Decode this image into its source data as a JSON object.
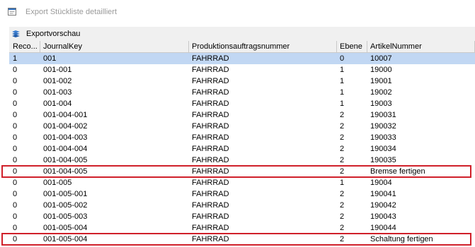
{
  "window": {
    "title": "Export Stückliste detailliert"
  },
  "toolbar": {
    "export_preview_label": "Exportvorschau"
  },
  "table": {
    "columns": [
      "Reco...",
      "JournalKey",
      "Produktionsauftragsnummer",
      "Ebene",
      "ArtikelNummer"
    ],
    "rows": [
      {
        "reco": "1",
        "journal_key": "001",
        "auftrag": "FAHRRAD",
        "ebene": "0",
        "artikel": "10007",
        "selected": true,
        "highlighted": false
      },
      {
        "reco": "0",
        "journal_key": "001-001",
        "auftrag": "FAHRRAD",
        "ebene": "1",
        "artikel": "19000",
        "selected": false,
        "highlighted": false
      },
      {
        "reco": "0",
        "journal_key": "001-002",
        "auftrag": "FAHRRAD",
        "ebene": "1",
        "artikel": "19001",
        "selected": false,
        "highlighted": false
      },
      {
        "reco": "0",
        "journal_key": "001-003",
        "auftrag": "FAHRRAD",
        "ebene": "1",
        "artikel": "19002",
        "selected": false,
        "highlighted": false
      },
      {
        "reco": "0",
        "journal_key": "001-004",
        "auftrag": "FAHRRAD",
        "ebene": "1",
        "artikel": "19003",
        "selected": false,
        "highlighted": false
      },
      {
        "reco": "0",
        "journal_key": "001-004-001",
        "auftrag": "FAHRRAD",
        "ebene": "2",
        "artikel": "190031",
        "selected": false,
        "highlighted": false
      },
      {
        "reco": "0",
        "journal_key": "001-004-002",
        "auftrag": "FAHRRAD",
        "ebene": "2",
        "artikel": "190032",
        "selected": false,
        "highlighted": false
      },
      {
        "reco": "0",
        "journal_key": "001-004-003",
        "auftrag": "FAHRRAD",
        "ebene": "2",
        "artikel": "190033",
        "selected": false,
        "highlighted": false
      },
      {
        "reco": "0",
        "journal_key": "001-004-004",
        "auftrag": "FAHRRAD",
        "ebene": "2",
        "artikel": "190034",
        "selected": false,
        "highlighted": false
      },
      {
        "reco": "0",
        "journal_key": "001-004-005",
        "auftrag": "FAHRRAD",
        "ebene": "2",
        "artikel": "190035",
        "selected": false,
        "highlighted": false
      },
      {
        "reco": "0",
        "journal_key": "001-004-005",
        "auftrag": "FAHRRAD",
        "ebene": "2",
        "artikel": "Bremse fertigen",
        "selected": false,
        "highlighted": true
      },
      {
        "reco": "0",
        "journal_key": "001-005",
        "auftrag": "FAHRRAD",
        "ebene": "1",
        "artikel": "19004",
        "selected": false,
        "highlighted": false
      },
      {
        "reco": "0",
        "journal_key": "001-005-001",
        "auftrag": "FAHRRAD",
        "ebene": "2",
        "artikel": "190041",
        "selected": false,
        "highlighted": false
      },
      {
        "reco": "0",
        "journal_key": "001-005-002",
        "auftrag": "FAHRRAD",
        "ebene": "2",
        "artikel": "190042",
        "selected": false,
        "highlighted": false
      },
      {
        "reco": "0",
        "journal_key": "001-005-003",
        "auftrag": "FAHRRAD",
        "ebene": "2",
        "artikel": "190043",
        "selected": false,
        "highlighted": false
      },
      {
        "reco": "0",
        "journal_key": "001-005-004",
        "auftrag": "FAHRRAD",
        "ebene": "2",
        "artikel": "190044",
        "selected": false,
        "highlighted": false
      },
      {
        "reco": "0",
        "journal_key": "001-005-004",
        "auftrag": "FAHRRAD",
        "ebene": "2",
        "artikel": "Schaltung fertigen",
        "selected": false,
        "highlighted": true
      }
    ]
  },
  "colors": {
    "selected_row": "#c1d7f3",
    "highlight_border": "#d0202a",
    "header_bg": "#f0f0f0",
    "title_text": "#9a9a9a"
  },
  "icons": {
    "app": "form-icon",
    "export_preview": "export-preview-icon"
  }
}
